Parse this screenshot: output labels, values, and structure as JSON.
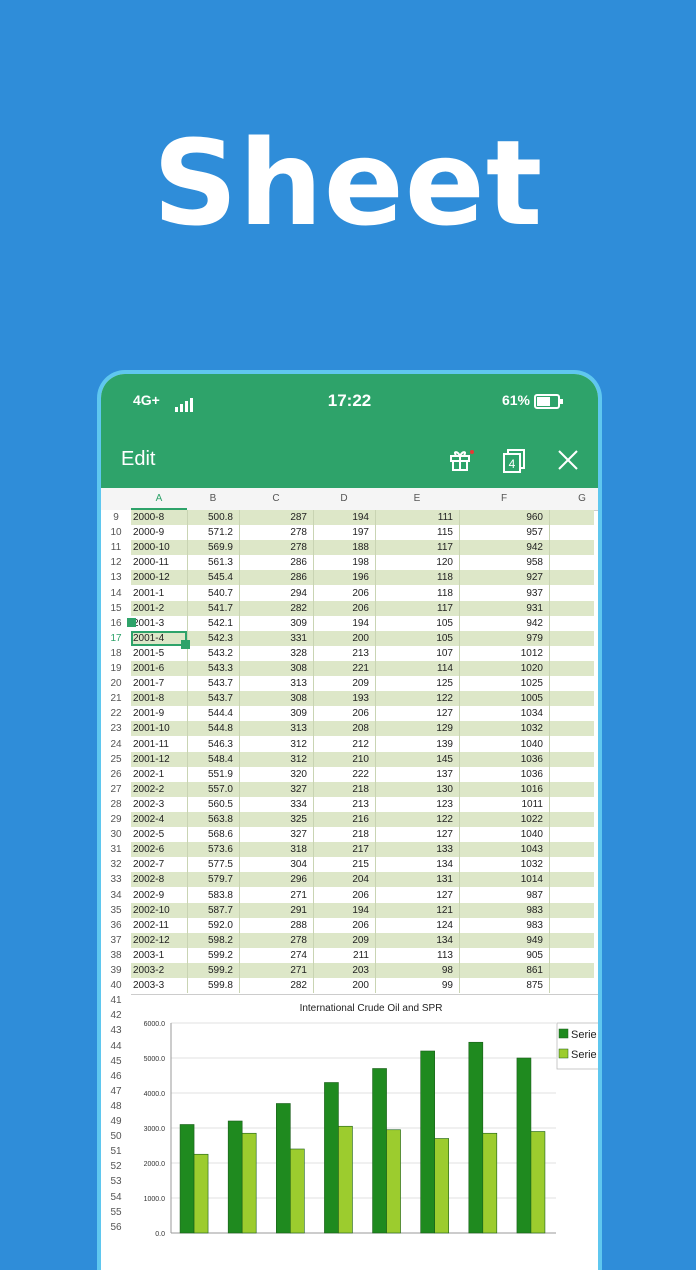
{
  "hero": {
    "title": "Sheet"
  },
  "status_bar": {
    "network": "4G+",
    "time": "17:22",
    "battery": "61%"
  },
  "toolbar": {
    "title": "Edit",
    "tab_count": "4"
  },
  "columns": [
    "A",
    "B",
    "C",
    "D",
    "E",
    "F",
    "G"
  ],
  "rows": [
    {
      "n": "9",
      "a": "2000-8",
      "b": "500.8",
      "c": "287",
      "d": "194",
      "e": "111",
      "f": "960"
    },
    {
      "n": "10",
      "a": "2000-9",
      "b": "571.2",
      "c": "278",
      "d": "197",
      "e": "115",
      "f": "957"
    },
    {
      "n": "11",
      "a": "2000-10",
      "b": "569.9",
      "c": "278",
      "d": "188",
      "e": "117",
      "f": "942"
    },
    {
      "n": "12",
      "a": "2000-11",
      "b": "561.3",
      "c": "286",
      "d": "198",
      "e": "120",
      "f": "958"
    },
    {
      "n": "13",
      "a": "2000-12",
      "b": "545.4",
      "c": "286",
      "d": "196",
      "e": "118",
      "f": "927"
    },
    {
      "n": "14",
      "a": "2001-1",
      "b": "540.7",
      "c": "294",
      "d": "206",
      "e": "118",
      "f": "937"
    },
    {
      "n": "15",
      "a": "2001-2",
      "b": "541.7",
      "c": "282",
      "d": "206",
      "e": "117",
      "f": "931"
    },
    {
      "n": "16",
      "a": "2001-3",
      "b": "542.1",
      "c": "309",
      "d": "194",
      "e": "105",
      "f": "942"
    },
    {
      "n": "17",
      "a": "2001-4",
      "b": "542.3",
      "c": "331",
      "d": "200",
      "e": "105",
      "f": "979"
    },
    {
      "n": "18",
      "a": "2001-5",
      "b": "543.2",
      "c": "328",
      "d": "213",
      "e": "107",
      "f": "1012"
    },
    {
      "n": "19",
      "a": "2001-6",
      "b": "543.3",
      "c": "308",
      "d": "221",
      "e": "114",
      "f": "1020"
    },
    {
      "n": "20",
      "a": "2001-7",
      "b": "543.7",
      "c": "313",
      "d": "209",
      "e": "125",
      "f": "1025"
    },
    {
      "n": "21",
      "a": "2001-8",
      "b": "543.7",
      "c": "308",
      "d": "193",
      "e": "122",
      "f": "1005"
    },
    {
      "n": "22",
      "a": "2001-9",
      "b": "544.4",
      "c": "309",
      "d": "206",
      "e": "127",
      "f": "1034"
    },
    {
      "n": "23",
      "a": "2001-10",
      "b": "544.8",
      "c": "313",
      "d": "208",
      "e": "129",
      "f": "1032"
    },
    {
      "n": "24",
      "a": "2001-11",
      "b": "546.3",
      "c": "312",
      "d": "212",
      "e": "139",
      "f": "1040"
    },
    {
      "n": "25",
      "a": "2001-12",
      "b": "548.4",
      "c": "312",
      "d": "210",
      "e": "145",
      "f": "1036"
    },
    {
      "n": "26",
      "a": "2002-1",
      "b": "551.9",
      "c": "320",
      "d": "222",
      "e": "137",
      "f": "1036"
    },
    {
      "n": "27",
      "a": "2002-2",
      "b": "557.0",
      "c": "327",
      "d": "218",
      "e": "130",
      "f": "1016"
    },
    {
      "n": "28",
      "a": "2002-3",
      "b": "560.5",
      "c": "334",
      "d": "213",
      "e": "123",
      "f": "1011"
    },
    {
      "n": "29",
      "a": "2002-4",
      "b": "563.8",
      "c": "325",
      "d": "216",
      "e": "122",
      "f": "1022"
    },
    {
      "n": "30",
      "a": "2002-5",
      "b": "568.6",
      "c": "327",
      "d": "218",
      "e": "127",
      "f": "1040"
    },
    {
      "n": "31",
      "a": "2002-6",
      "b": "573.6",
      "c": "318",
      "d": "217",
      "e": "133",
      "f": "1043"
    },
    {
      "n": "32",
      "a": "2002-7",
      "b": "577.5",
      "c": "304",
      "d": "215",
      "e": "134",
      "f": "1032"
    },
    {
      "n": "33",
      "a": "2002-8",
      "b": "579.7",
      "c": "296",
      "d": "204",
      "e": "131",
      "f": "1014"
    },
    {
      "n": "34",
      "a": "2002-9",
      "b": "583.8",
      "c": "271",
      "d": "206",
      "e": "127",
      "f": "987"
    },
    {
      "n": "35",
      "a": "2002-10",
      "b": "587.7",
      "c": "291",
      "d": "194",
      "e": "121",
      "f": "983"
    },
    {
      "n": "36",
      "a": "2002-11",
      "b": "592.0",
      "c": "288",
      "d": "206",
      "e": "124",
      "f": "983"
    },
    {
      "n": "37",
      "a": "2002-12",
      "b": "598.2",
      "c": "278",
      "d": "209",
      "e": "134",
      "f": "949"
    },
    {
      "n": "38",
      "a": "2003-1",
      "b": "599.2",
      "c": "274",
      "d": "211",
      "e": "113",
      "f": "905"
    },
    {
      "n": "39",
      "a": "2003-2",
      "b": "599.2",
      "c": "271",
      "d": "203",
      "e": "98",
      "f": "861"
    },
    {
      "n": "40",
      "a": "2003-3",
      "b": "599.8",
      "c": "282",
      "d": "200",
      "e": "99",
      "f": "875"
    }
  ],
  "empty_row_numbers": [
    "41",
    "42",
    "43",
    "44",
    "45",
    "46",
    "47",
    "48",
    "49",
    "50",
    "51",
    "52",
    "53",
    "54",
    "55",
    "56"
  ],
  "chart_data": {
    "type": "bar",
    "title": "International Crude Oil and SPR",
    "ylim": [
      0,
      6000
    ],
    "yticks": [
      "0.0",
      "1000.0",
      "2000.0",
      "3000.0",
      "4000.0",
      "5000.0",
      "6000.0"
    ],
    "series": [
      {
        "name": "Serie",
        "color": "#1f8a1f",
        "values": [
          3100,
          3200,
          3700,
          4300,
          4700,
          5200,
          5450,
          5000
        ]
      },
      {
        "name": "Serie",
        "color": "#9ccc2e",
        "values": [
          2250,
          2850,
          2400,
          3050,
          2950,
          2700,
          2850,
          2900
        ]
      }
    ],
    "legend": "right"
  }
}
